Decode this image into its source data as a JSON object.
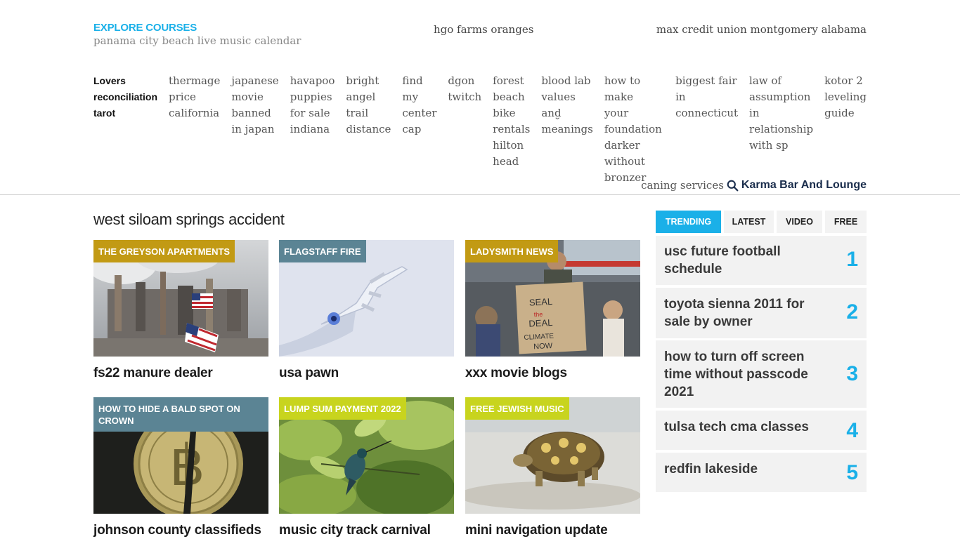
{
  "header": {
    "brand": "EXPLORE COURSES",
    "brand_sub": "panama city beach live music calendar",
    "mid_link": "hgo farms oranges",
    "right_link": "max credit union montgomery alabama"
  },
  "nav": {
    "items": [
      [
        "Lovers",
        "reconciliation",
        "tarot"
      ],
      [
        "thermage",
        "price",
        "california"
      ],
      [
        "japanese",
        "movie",
        "banned",
        "in japan"
      ],
      [
        "havapoo",
        "puppies",
        "for sale",
        "indiana"
      ],
      [
        "bright",
        "angel",
        "trail",
        "distance"
      ],
      [
        "find",
        "my",
        "center",
        "cap"
      ],
      [
        "dgon",
        "twitch"
      ],
      [
        "forest",
        "beach",
        "bike",
        "rentals",
        "hilton",
        "head"
      ],
      [
        "blood lab",
        "values",
        "and",
        "meanings"
      ],
      [
        "how to make",
        "your",
        "foundation",
        "darker",
        "without",
        "bronzer"
      ],
      [
        "biggest fair",
        "in",
        "connecticut"
      ],
      [
        "law of",
        "assumption",
        "in",
        "relationship",
        "with sp"
      ],
      [
        "kotor 2",
        "leveling",
        "guide"
      ]
    ]
  },
  "search": {
    "text": "caning services",
    "site_name": "Karma Bar And Lounge",
    "icon": "search-icon"
  },
  "main": {
    "section_title": "west siloam springs accident",
    "cards": [
      {
        "tag": "THE GREYSON APARTMENTS",
        "tag_color": "#c29a14",
        "headline": "fs22 manure dealer",
        "image": "refinery-with-flags"
      },
      {
        "tag": "FLAGSTAFF FIRE",
        "tag_color": "#5b8494",
        "headline": "usa pawn",
        "image": "robot-hand"
      },
      {
        "tag": "LADYSMITH NEWS",
        "tag_color": "#c29a14",
        "headline": "xxx movie blogs",
        "image": "climate-protest"
      },
      {
        "tag": "HOW TO HIDE A BALD SPOT ON CROWN",
        "tag_color": "#5b8494",
        "headline": "johnson county classifieds",
        "image": "bitcoin-coin"
      },
      {
        "tag": "LUMP SUM PAYMENT 2022",
        "tag_color": "#c8d41e",
        "headline": "music city track carnival",
        "image": "hummingbird"
      },
      {
        "tag": "FREE JEWISH MUSIC",
        "tag_color": "#c8d41e",
        "headline": "mini navigation update",
        "image": "tortoise"
      }
    ]
  },
  "sidebar": {
    "tabs": [
      "TRENDING",
      "LATEST",
      "VIDEO",
      "FREE"
    ],
    "active_tab": "TRENDING",
    "trending": [
      {
        "title": "usc future football schedule",
        "num": "1"
      },
      {
        "title": "toyota sienna 2011 for sale by owner",
        "num": "2"
      },
      {
        "title": "how to turn off screen time without passcode 2021",
        "num": "3"
      },
      {
        "title": "tulsa tech cma classes",
        "num": "4"
      },
      {
        "title": "redfin lakeside",
        "num": "5"
      }
    ]
  },
  "colors": {
    "accent": "#1ab0e8",
    "nav_dark": "#1a2d4c"
  }
}
